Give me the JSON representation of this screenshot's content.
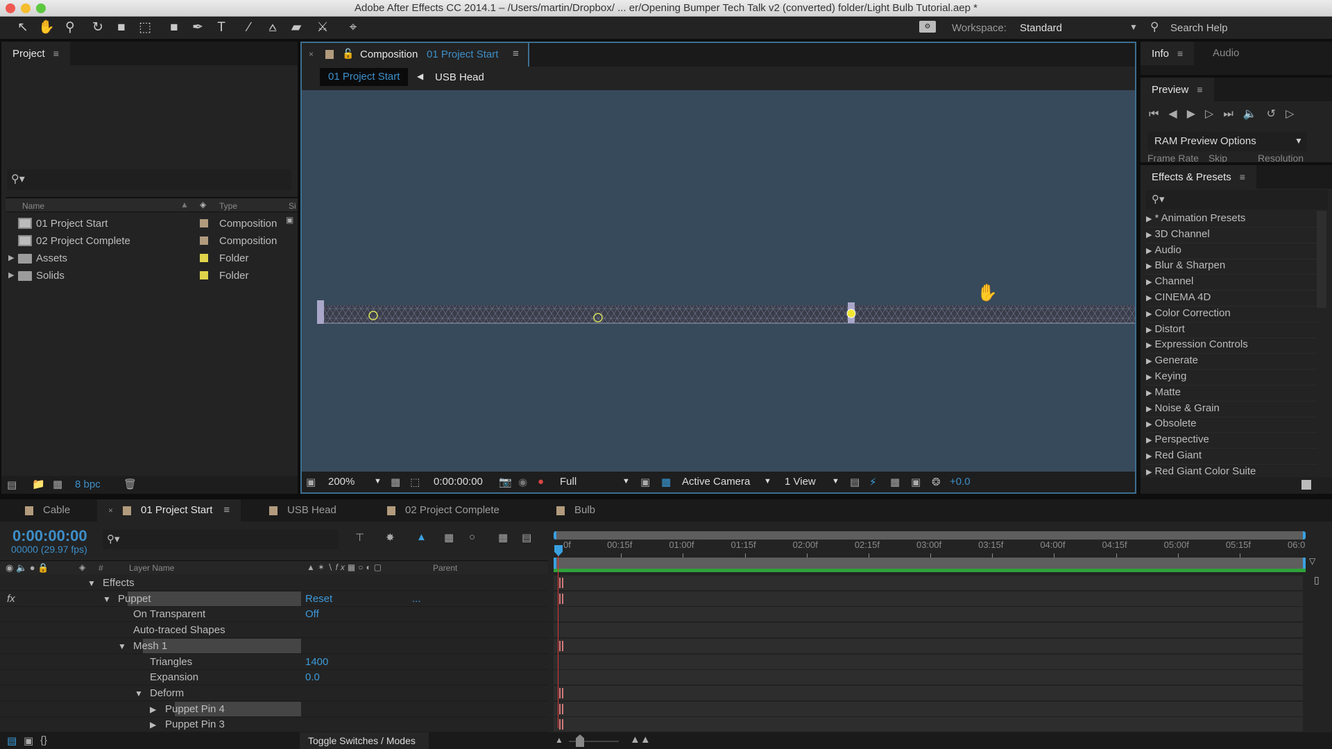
{
  "window": {
    "title": "Adobe After Effects CC 2014.1 – /Users/martin/Dropbox/ ... er/Opening Bumper Tech Talk v2 (converted) folder/Light Bulb Tutorial.aep *",
    "traffic_colors": {
      "close": "#ee5a52",
      "minimize": "#f5bd2f",
      "zoom": "#5dc83f"
    }
  },
  "toolbar": {
    "tools": [
      {
        "name": "selection-tool",
        "glyph": "↖"
      },
      {
        "name": "hand-tool",
        "glyph": "✋",
        "active": true
      },
      {
        "name": "zoom-tool",
        "glyph": "⚲"
      },
      {
        "name": "rotation-tool",
        "glyph": "↻"
      },
      {
        "name": "camera-tool",
        "glyph": "■"
      },
      {
        "name": "pan-behind-tool",
        "glyph": "⬚"
      },
      {
        "name": "rectangle-tool",
        "glyph": "■"
      },
      {
        "name": "pen-tool",
        "glyph": "✒"
      },
      {
        "name": "type-tool",
        "glyph": "T"
      },
      {
        "name": "brush-tool",
        "glyph": "∕"
      },
      {
        "name": "clone-stamp-tool",
        "glyph": "⩟"
      },
      {
        "name": "eraser-tool",
        "glyph": "▰"
      },
      {
        "name": "roto-brush-tool",
        "glyph": "⚔"
      },
      {
        "name": "puppet-pin-tool",
        "glyph": "⌖"
      }
    ],
    "workspace_label": "Workspace:",
    "workspace_value": "Standard",
    "search_help": "Search Help"
  },
  "project": {
    "tab": "Project",
    "columns": {
      "name": "Name",
      "type": "Type",
      "size": "Si"
    },
    "items": [
      {
        "name": "01 Project Start",
        "type": "Composition",
        "kind": "comp",
        "label_color": "#b29b7d"
      },
      {
        "name": "02 Project Complete",
        "type": "Composition",
        "kind": "comp",
        "label_color": "#b29b7d"
      },
      {
        "name": "Assets",
        "type": "Folder",
        "kind": "folder",
        "label_color": "#e0d34a"
      },
      {
        "name": "Solids",
        "type": "Folder",
        "kind": "folder",
        "label_color": "#e0d34a"
      }
    ],
    "bpc": "8 bpc"
  },
  "composition": {
    "tab_prefix": "Composition",
    "tab_name": "01 Project Start",
    "breadcrumbs": [
      "01 Project Start",
      "USB Head"
    ],
    "footer": {
      "zoom": "200%",
      "timecode": "0:00:00:00",
      "resolution": "Full",
      "camera": "Active Camera",
      "views": "1 View",
      "exposure": "+0.0"
    }
  },
  "info": {
    "tabs": [
      "Info",
      "Audio"
    ]
  },
  "preview": {
    "tab": "Preview",
    "ram_options": "RAM Preview Options",
    "sub_labels": [
      "Frame Rate",
      "Skip",
      "Resolution"
    ]
  },
  "effects": {
    "tab": "Effects & Presets",
    "items": [
      "* Animation Presets",
      "3D Channel",
      "Audio",
      "Blur & Sharpen",
      "Channel",
      "CINEMA 4D",
      "Color Correction",
      "Distort",
      "Expression Controls",
      "Generate",
      "Keying",
      "Matte",
      "Noise & Grain",
      "Obsolete",
      "Perspective",
      "Red Giant",
      "Red Giant Color Suite"
    ]
  },
  "timeline": {
    "tabs": [
      {
        "label": "Cable",
        "active": false
      },
      {
        "label": "01 Project Start",
        "active": true
      },
      {
        "label": "USB Head",
        "active": false
      },
      {
        "label": "02 Project Complete",
        "active": false
      },
      {
        "label": "Bulb",
        "active": false
      }
    ],
    "timecode": "0:00:00:00",
    "frames": "00000 (29.97 fps)",
    "columns": {
      "hash": "#",
      "layer_name": "Layer Name",
      "parent": "Parent"
    },
    "rows": [
      {
        "label": "Effects",
        "indent": 0,
        "twirl": "open"
      },
      {
        "label": "Puppet",
        "indent": 1,
        "twirl": "open",
        "value": "Reset",
        "extra": "...",
        "highlight": true,
        "fx": true
      },
      {
        "label": "On Transparent",
        "indent": 2,
        "value": "Off"
      },
      {
        "label": "Auto-traced Shapes",
        "indent": 2
      },
      {
        "label": "Mesh 1",
        "indent": 2,
        "twirl": "open",
        "highlight": true
      },
      {
        "label": "Triangles",
        "indent": 3,
        "value": "1400"
      },
      {
        "label": "Expansion",
        "indent": 3,
        "value": "0.0"
      },
      {
        "label": "Deform",
        "indent": 3,
        "twirl": "open"
      },
      {
        "label": "Puppet Pin 4",
        "indent": 4,
        "twirl": "closed",
        "highlight": true
      },
      {
        "label": "Puppet Pin 3",
        "indent": 4,
        "twirl": "closed"
      }
    ],
    "ruler": [
      "0f",
      "00:15f",
      "01:00f",
      "01:15f",
      "02:00f",
      "02:15f",
      "03:00f",
      "03:15f",
      "04:00f",
      "04:15f",
      "05:00f",
      "05:15f",
      "06:0"
    ],
    "keyframe_rows": [
      0,
      1,
      4,
      7,
      8,
      9
    ],
    "toggle_label": "Toggle Switches / Modes"
  }
}
